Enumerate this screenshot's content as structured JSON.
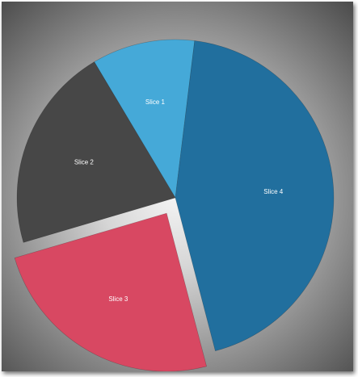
{
  "chart_data": {
    "type": "pie",
    "slices": [
      {
        "label": "Slice 1",
        "value": 10.5,
        "color": "#45a9d8"
      },
      {
        "label": "Slice 2",
        "value": 21.0,
        "color": "#474747"
      },
      {
        "label": "Slice 3",
        "value": 24.5,
        "color": "#d84862",
        "exploded": true
      },
      {
        "label": "Slice 4",
        "value": 44.0,
        "color": "#216f9e"
      }
    ],
    "title": "",
    "legend": "none"
  }
}
